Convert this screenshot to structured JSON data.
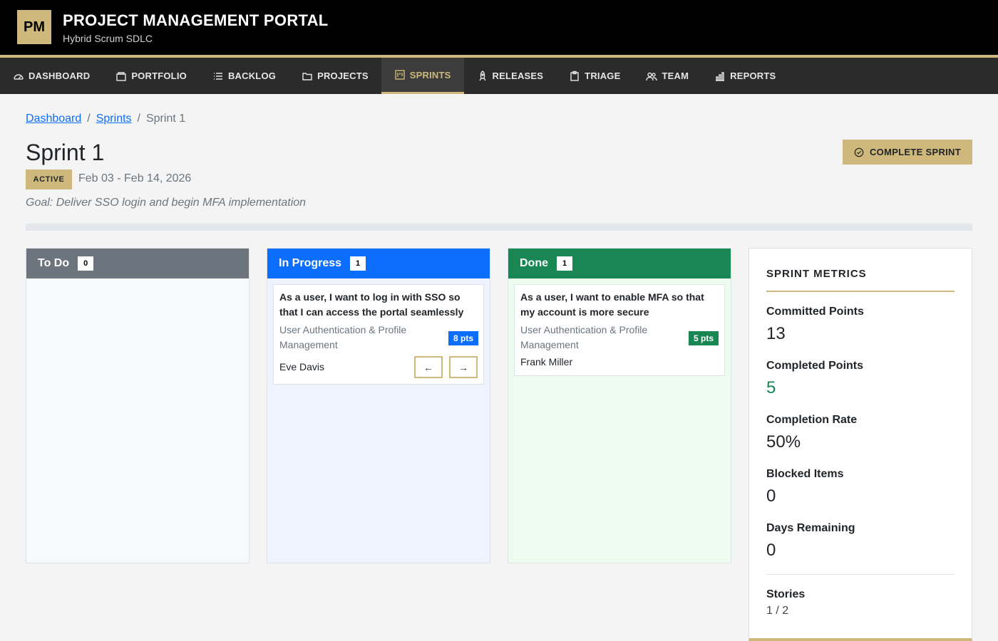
{
  "app": {
    "logo": "PM",
    "title": "PROJECT MANAGEMENT PORTAL",
    "subtitle": "Hybrid Scrum SDLC"
  },
  "nav": [
    {
      "label": "DASHBOARD",
      "icon": "dashboard-icon"
    },
    {
      "label": "PORTFOLIO",
      "icon": "portfolio-icon"
    },
    {
      "label": "BACKLOG",
      "icon": "backlog-icon"
    },
    {
      "label": "PROJECTS",
      "icon": "folder-icon"
    },
    {
      "label": "SPRINTS",
      "icon": "kanban-icon",
      "active": true
    },
    {
      "label": "RELEASES",
      "icon": "rocket-icon"
    },
    {
      "label": "TRIAGE",
      "icon": "clipboard-icon"
    },
    {
      "label": "TEAM",
      "icon": "people-icon"
    },
    {
      "label": "REPORTS",
      "icon": "bar-chart-icon"
    }
  ],
  "breadcrumb": {
    "home": "Dashboard",
    "parent": "Sprints",
    "sep": "/",
    "current": "Sprint 1"
  },
  "sprint": {
    "title": "Sprint 1",
    "status": "ACTIVE",
    "dates": "Feb 03 - Feb 14, 2026",
    "goal": "Goal: Deliver SSO login and begin MFA implementation",
    "complete_label": "COMPLETE SPRINT"
  },
  "columns": {
    "todo": {
      "title": "To Do",
      "count": "0"
    },
    "in_progress": {
      "title": "In Progress",
      "count": "1",
      "card": {
        "title": "As a user, I want to log in with SSO so that I can access the portal seamlessly",
        "epic": "User Authentication & Profile Management",
        "points": "8 pts",
        "assignee": "Eve Davis",
        "prev": "←",
        "next": "→"
      }
    },
    "done": {
      "title": "Done",
      "count": "1",
      "card": {
        "title": "As a user, I want to enable MFA so that my account is more secure",
        "epic": "User Authentication & Profile Management",
        "points": "5 pts",
        "assignee": "Frank Miller"
      }
    }
  },
  "metrics": {
    "title": "SPRINT METRICS",
    "committed_label": "Committed Points",
    "committed": "13",
    "completed_label": "Completed Points",
    "completed": "5",
    "rate_label": "Completion Rate",
    "rate": "50%",
    "blocked_label": "Blocked Items",
    "blocked": "0",
    "days_label": "Days Remaining",
    "days": "0",
    "stories_label": "Stories",
    "stories": "1 / 2"
  },
  "colors": {
    "gold": "#cfb87c",
    "todo": "#6c757d",
    "in_progress": "#0d6efd",
    "done": "#198754",
    "completed_value": "#198754"
  }
}
